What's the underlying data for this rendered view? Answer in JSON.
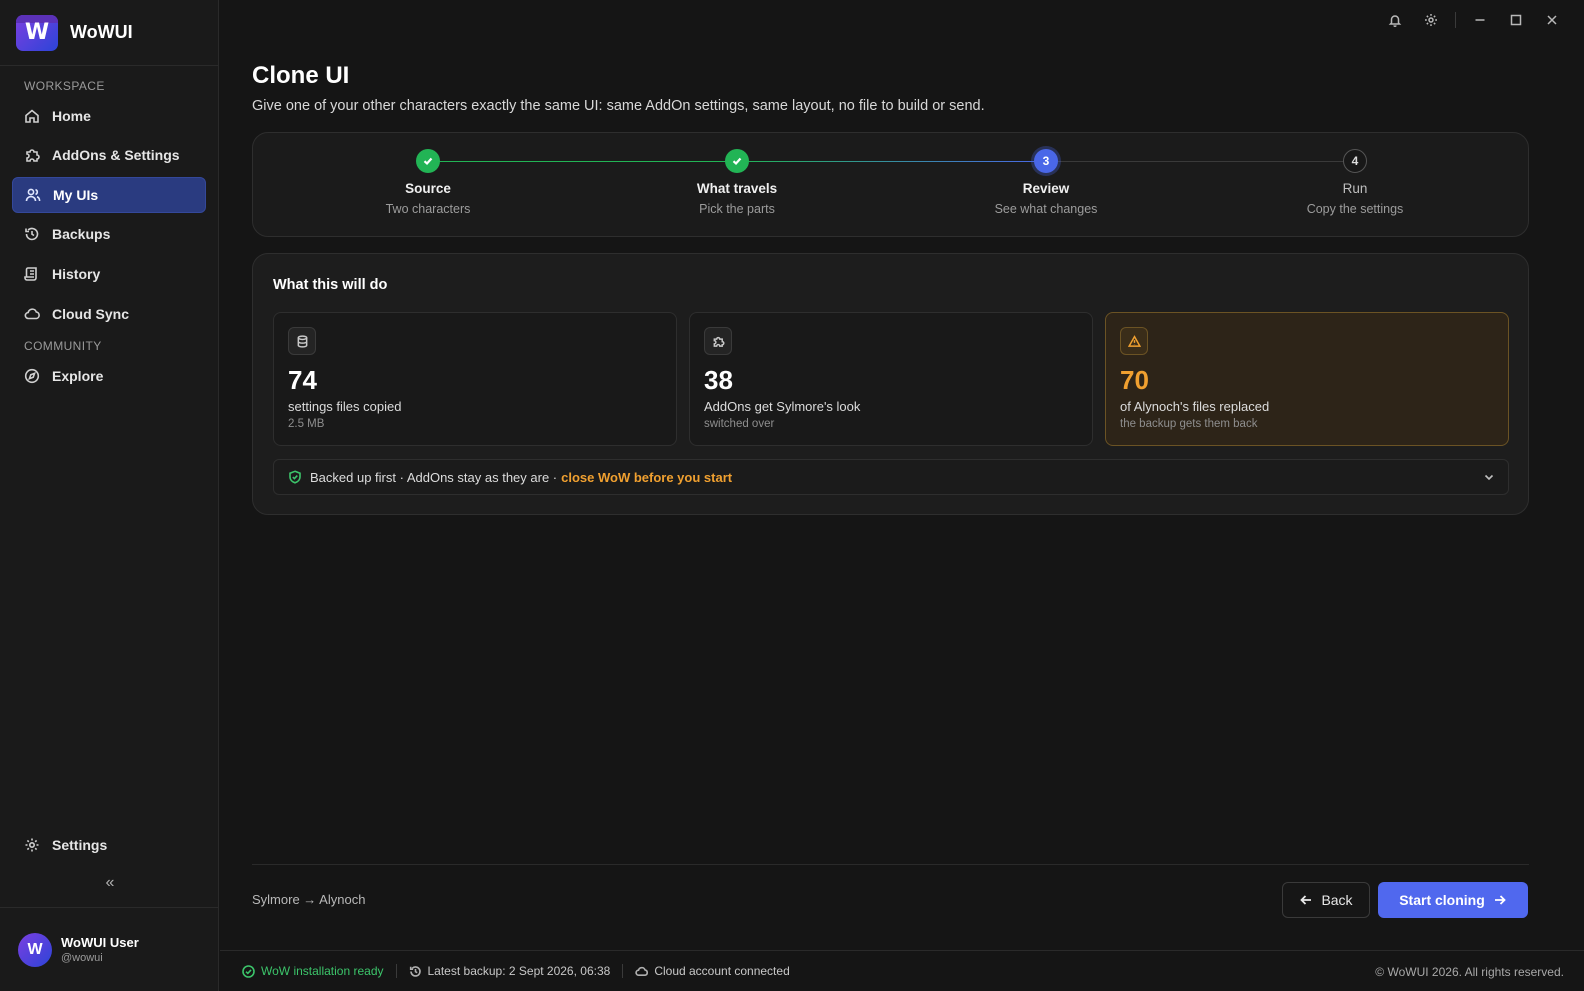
{
  "app": {
    "name": "WoWUI",
    "logo_letter": "W"
  },
  "sidebar": {
    "sections": [
      "WORKSPACE",
      "COMMUNITY"
    ],
    "items": [
      {
        "label": "Home",
        "icon": "home-icon"
      },
      {
        "label": "AddOns & Settings",
        "icon": "puzzle-icon"
      },
      {
        "label": "My UIs",
        "icon": "users-icon",
        "active": true
      },
      {
        "label": "Backups",
        "icon": "history-icon"
      },
      {
        "label": "History",
        "icon": "scroll-icon"
      },
      {
        "label": "Cloud Sync",
        "icon": "cloud-icon"
      },
      {
        "label": "Explore",
        "icon": "compass-icon"
      }
    ],
    "settings_label": "Settings",
    "collapse_glyph": "«",
    "user": {
      "name": "WoWUI User",
      "handle": "@wowui",
      "avatar_letter": "W"
    }
  },
  "page": {
    "title": "Clone UI",
    "subtitle": "Give one of your other characters exactly the same UI: same AddOn settings, same layout, no file to build or send."
  },
  "steps": [
    {
      "title": "Source",
      "desc": "Two characters",
      "state": "done"
    },
    {
      "title": "What travels",
      "desc": "Pick the parts",
      "state": "done"
    },
    {
      "title": "Review",
      "desc": "See what changes",
      "state": "current",
      "number": "3"
    },
    {
      "title": "Run",
      "desc": "Copy the settings",
      "state": "todo",
      "number": "4"
    }
  ],
  "summary": {
    "title": "What this will do",
    "stats": [
      {
        "value": "74",
        "label": "settings files copied",
        "note": "2.5 MB",
        "icon": "database-icon"
      },
      {
        "value": "38",
        "label": "AddOns get Sylmore's look",
        "note": "switched over",
        "icon": "puzzle-icon"
      },
      {
        "value": "70",
        "label": "of Alynoch's files replaced",
        "note": "the backup gets them back",
        "icon": "warning-icon",
        "warn": true
      }
    ],
    "notice": {
      "text": "Backed up first · AddOns stay as they are ·",
      "warning": "close WoW before you start"
    }
  },
  "footer": {
    "route": "Sylmore → Alynoch",
    "back_label": "Back",
    "start_label": "Start cloning"
  },
  "status": {
    "install": "WoW installation ready",
    "backup": "Latest backup: 2 Sept 2026, 06:38",
    "cloud": "Cloud account connected",
    "copyright": "© WoWUI 2026. All rights reserved."
  },
  "colors": {
    "accent": "#5068ee",
    "success": "#22b455",
    "warning": "#f0a030",
    "active_nav": "#2a3b80"
  }
}
